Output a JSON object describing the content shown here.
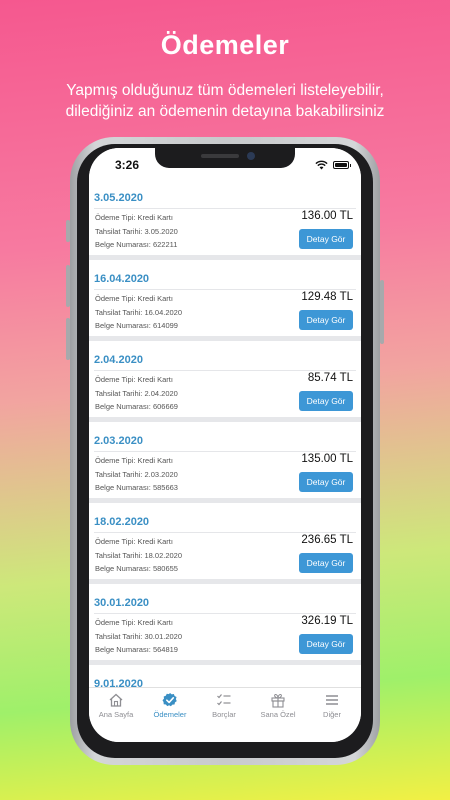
{
  "hero": {
    "title": "Ödemeler",
    "subtitle_line1": "Yapmış olduğunuz tüm ödemeleri listeleyebilir,",
    "subtitle_line2": "dilediğiniz an ödemenin detayına bakabilirsiniz"
  },
  "status_bar": {
    "time": "3:26"
  },
  "payments": [
    {
      "date": "3.05.2020",
      "type": "Ödeme Tipi: Kredi Kartı",
      "collection_date": "Tahsilat Tarihi: 3.05.2020",
      "doc_no": "Belge Numarası: 622211",
      "amount": "136.00 TL",
      "button": "Detay Gör"
    },
    {
      "date": "16.04.2020",
      "type": "Ödeme Tipi: Kredi Kartı",
      "collection_date": "Tahsilat Tarihi: 16.04.2020",
      "doc_no": "Belge Numarası: 614099",
      "amount": "129.48 TL",
      "button": "Detay Gör"
    },
    {
      "date": "2.04.2020",
      "type": "Ödeme Tipi: Kredi Kartı",
      "collection_date": "Tahsilat Tarihi: 2.04.2020",
      "doc_no": "Belge Numarası: 606669",
      "amount": "85.74 TL",
      "button": "Detay Gör"
    },
    {
      "date": "2.03.2020",
      "type": "Ödeme Tipi: Kredi Kartı",
      "collection_date": "Tahsilat Tarihi: 2.03.2020",
      "doc_no": "Belge Numarası: 585663",
      "amount": "135.00 TL",
      "button": "Detay Gör"
    },
    {
      "date": "18.02.2020",
      "type": "Ödeme Tipi: Kredi Kartı",
      "collection_date": "Tahsilat Tarihi: 18.02.2020",
      "doc_no": "Belge Numarası: 580655",
      "amount": "236.65 TL",
      "button": "Detay Gör"
    },
    {
      "date": "30.01.2020",
      "type": "Ödeme Tipi: Kredi Kartı",
      "collection_date": "Tahsilat Tarihi: 30.01.2020",
      "doc_no": "Belge Numarası: 564819",
      "amount": "326.19 TL",
      "button": "Detay Gör"
    }
  ],
  "partial_next_date": "9.01.2020",
  "tabs": [
    {
      "label": "Ana Sayfa",
      "icon": "home-icon",
      "active": false
    },
    {
      "label": "Ödemeler",
      "icon": "check-badge-icon",
      "active": true
    },
    {
      "label": "Borçlar",
      "icon": "checklist-icon",
      "active": false
    },
    {
      "label": "Sana Özel",
      "icon": "gift-icon",
      "active": false
    },
    {
      "label": "Diğer",
      "icon": "menu-icon",
      "active": false
    }
  ],
  "colors": {
    "accent": "#3a8fc4",
    "button": "#3d97d6",
    "inactive_tab": "#8e8e93"
  }
}
